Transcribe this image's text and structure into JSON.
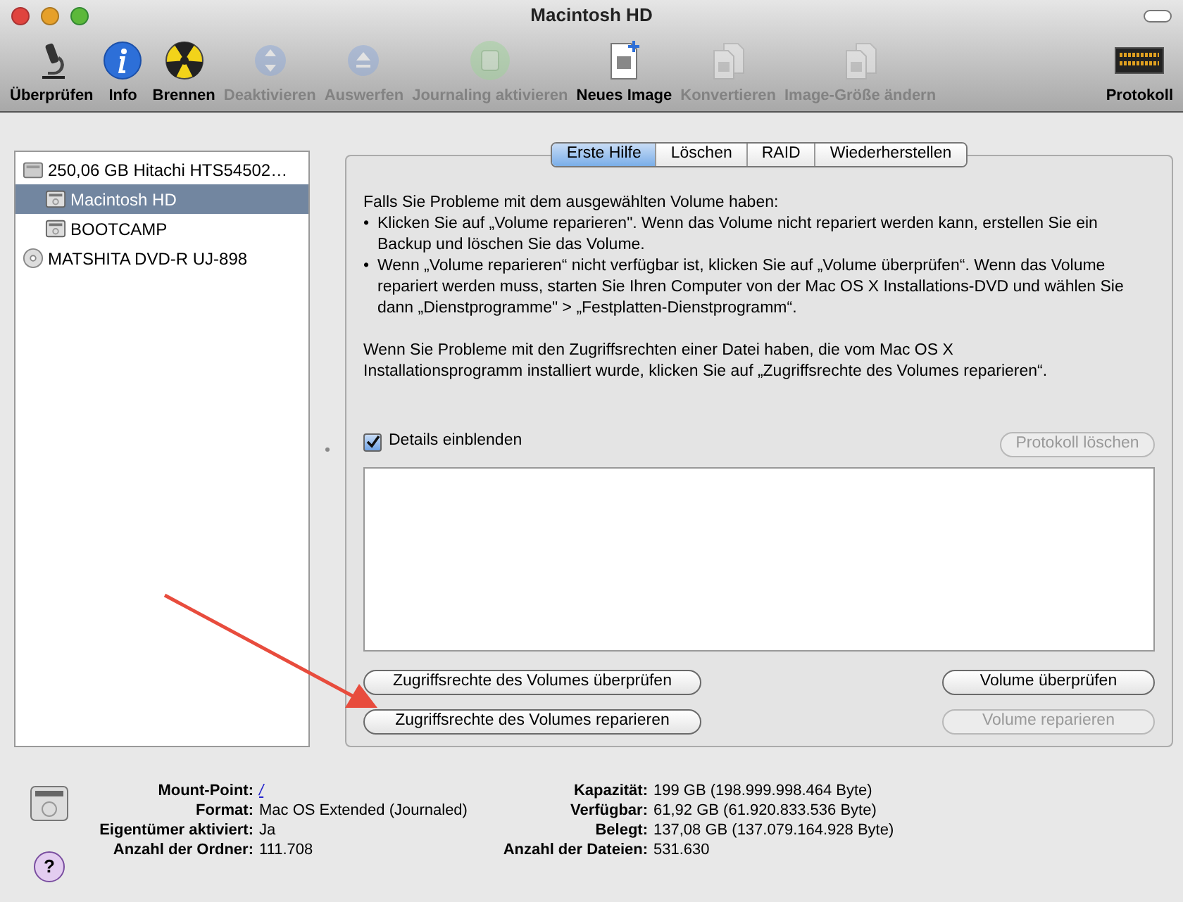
{
  "window": {
    "title": "Macintosh HD"
  },
  "toolbar": [
    {
      "kind": "verify",
      "label": "Überprüfen",
      "disabled": false
    },
    {
      "kind": "info",
      "label": "Info",
      "disabled": false
    },
    {
      "kind": "burn",
      "label": "Brennen",
      "disabled": false
    },
    {
      "kind": "unmount",
      "label": "Deaktivieren",
      "disabled": true
    },
    {
      "kind": "eject",
      "label": "Auswerfen",
      "disabled": true
    },
    {
      "kind": "journal",
      "label": "Journaling aktivieren",
      "disabled": true
    },
    {
      "kind": "newimage",
      "label": "Neues Image",
      "disabled": false
    },
    {
      "kind": "convert",
      "label": "Konvertieren",
      "disabled": true
    },
    {
      "kind": "resize",
      "label": "Image-Größe ändern",
      "disabled": true
    },
    {
      "kind": "log",
      "label": "Protokoll",
      "disabled": false
    }
  ],
  "sidebar": {
    "items": [
      {
        "kind": "disk",
        "label": "250,06 GB Hitachi HTS54502…",
        "selected": false,
        "children": [
          {
            "kind": "volume",
            "label": "Macintosh HD",
            "selected": true
          },
          {
            "kind": "volume",
            "label": "BOOTCAMP",
            "selected": false
          }
        ]
      },
      {
        "kind": "optical",
        "label": "MATSHITA DVD-R UJ-898",
        "selected": false
      }
    ]
  },
  "tabs": [
    {
      "label": "Erste Hilfe",
      "selected": true
    },
    {
      "label": "Löschen",
      "selected": false
    },
    {
      "label": "RAID",
      "selected": false
    },
    {
      "label": "Wiederherstellen",
      "selected": false
    }
  ],
  "first_aid": {
    "intro": "Falls Sie Probleme mit dem ausgewählten Volume haben:",
    "bullets": [
      "•",
      "•"
    ],
    "bullet_texts": [
      "Klicken Sie auf „Volume reparieren\". Wenn das Volume nicht repariert werden kann, erstellen Sie ein Backup und löschen Sie das Volume.",
      "Wenn „Volume reparieren“ nicht verfügbar ist, klicken Sie auf „Volume überprüfen“. Wenn das Volume repariert werden muss, starten Sie Ihren Computer von der Mac OS X Installations-DVD und wählen Sie dann „Dienstprogramme\" > „Festplatten-Dienstprogramm“."
    ],
    "note": "Wenn Sie Probleme mit den Zugriffsrechten einer Datei haben, die vom Mac OS X Installationsprogramm installiert wurde, klicken Sie auf „Zugriffsrechte des Volumes reparieren“.",
    "details": {
      "label": "Details einblenden",
      "checked": true
    },
    "clear_log": {
      "label": "Protokoll löschen",
      "disabled": true
    },
    "buttons": [
      {
        "label": "Zugriffsrechte des Volumes überprüfen",
        "disabled": false
      },
      {
        "label": "Volume überprüfen",
        "disabled": false
      },
      {
        "label": "Zugriffsrechte des Volumes reparieren",
        "disabled": false
      },
      {
        "label": "Volume reparieren",
        "disabled": true
      }
    ]
  },
  "info": {
    "left": [
      {
        "label": "Mount-Point:",
        "value": "/",
        "kind": "link"
      },
      {
        "label": "Format:",
        "value": "Mac OS Extended (Journaled)"
      },
      {
        "label": "Eigentümer aktiviert:",
        "value": "Ja"
      },
      {
        "label": "Anzahl der Ordner:",
        "value": "111.708"
      }
    ],
    "right": [
      {
        "label": "Kapazität:",
        "value": "199 GB (198.999.998.464 Byte)"
      },
      {
        "label": "Verfügbar:",
        "value": "61,92 GB (61.920.833.536 Byte)"
      },
      {
        "label": "Belegt:",
        "value": "137,08 GB (137.079.164.928 Byte)"
      },
      {
        "label": "Anzahl der Dateien:",
        "value": "531.630"
      }
    ],
    "help": "?"
  }
}
